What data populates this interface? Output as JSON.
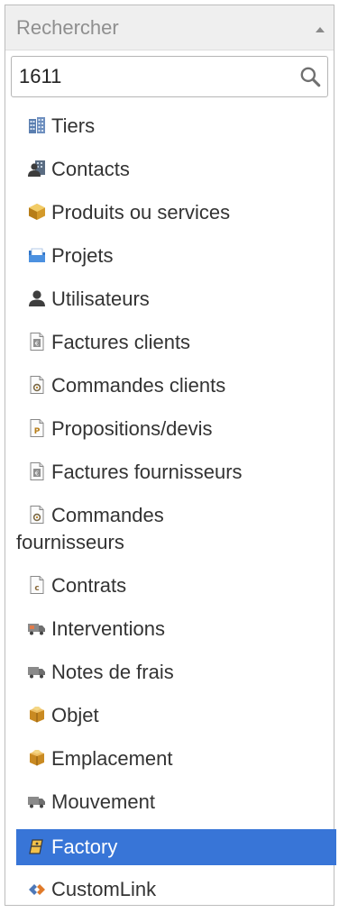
{
  "header": {
    "label": "Rechercher"
  },
  "search": {
    "value": "1611"
  },
  "items": [
    {
      "label": "Tiers",
      "icon": "building-icon"
    },
    {
      "label": "Contacts",
      "icon": "contacts-icon"
    },
    {
      "label": "Produits ou services",
      "icon": "product-box-icon"
    },
    {
      "label": "Projets",
      "icon": "project-folder-icon"
    },
    {
      "label": "Utilisateurs",
      "icon": "user-icon"
    },
    {
      "label": "Factures clients",
      "icon": "invoice-icon"
    },
    {
      "label": "Commandes clients",
      "icon": "order-icon"
    },
    {
      "label": "Propositions/devis",
      "icon": "proposal-icon"
    },
    {
      "label": "Factures fournisseurs",
      "icon": "invoice-icon"
    },
    {
      "label_line1": "Commandes",
      "label_line2": "fournisseurs",
      "icon": "order-icon"
    },
    {
      "label": "Contrats",
      "icon": "contract-icon"
    },
    {
      "label": "Interventions",
      "icon": "intervention-truck-icon"
    },
    {
      "label": "Notes de frais",
      "icon": "truck-icon"
    },
    {
      "label": "Objet",
      "icon": "package-icon"
    },
    {
      "label": "Emplacement",
      "icon": "package-icon"
    },
    {
      "label": "Mouvement",
      "icon": "truck-icon"
    },
    {
      "label": "Factory",
      "icon": "factory-icon",
      "selected": true
    },
    {
      "label": "CustomLink",
      "icon": "customlink-icon"
    }
  ],
  "colors": {
    "selected_bg": "#3875d7",
    "header_bg": "#efefef",
    "text": "#333333"
  }
}
